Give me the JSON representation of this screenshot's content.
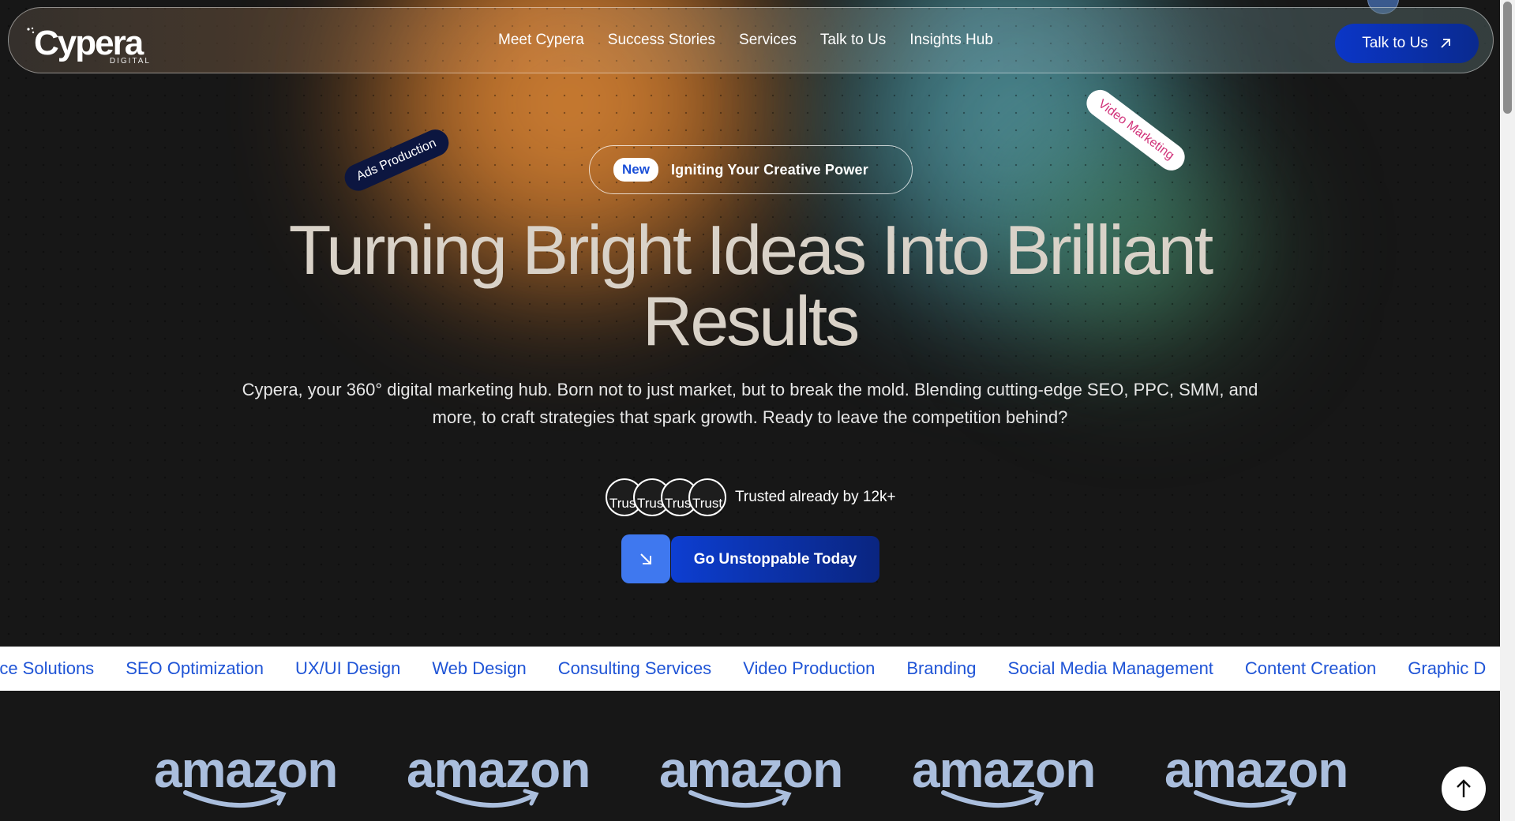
{
  "brand": {
    "name": "Cypera",
    "tagline": "DIGITAL"
  },
  "nav": {
    "links": [
      "Meet Cypera",
      "Success Stories",
      "Services",
      "Talk to Us",
      "Insights Hub"
    ],
    "cta_label": "Talk to Us"
  },
  "tags": {
    "ads": "Ads Production",
    "video": "Video Marketing"
  },
  "badge": {
    "new_label": "New",
    "text": "Igniting Your Creative Power"
  },
  "hero": {
    "title": "Turning Bright Ideas Into Brilliant Results",
    "subtitle": "Cypera, your 360° digital marketing hub. Born not to just market, but to break the mold. Blending cutting-edge SEO, PPC, SMM, and more, to craft strategies that spark growth. Ready to leave the competition behind?"
  },
  "trust": {
    "avatar_alt": [
      "Trust",
      "Trust",
      "Trust",
      "Trust"
    ],
    "text": "Trusted already by 12k+"
  },
  "cta": {
    "label": "Go Unstoppable Today"
  },
  "services_marquee": [
    "rce Solutions",
    "SEO Optimization",
    "UX/UI Design",
    "Web Design",
    "Consulting Services",
    "Video Production",
    "Branding",
    "Social Media Management",
    "Content Creation",
    "Graphic D"
  ],
  "client_logos": [
    "amazon",
    "amazon",
    "amazon",
    "amazon",
    "amazon"
  ],
  "colors": {
    "accent": "#0b36c7",
    "accent_light": "#3f78ef",
    "background": "#171717",
    "marquee_text": "#1f54d6"
  },
  "icons": {
    "cta_nav": "arrow-up-right-icon",
    "cta_main": "arrow-down-right-icon",
    "back_top": "arrow-up-icon"
  }
}
